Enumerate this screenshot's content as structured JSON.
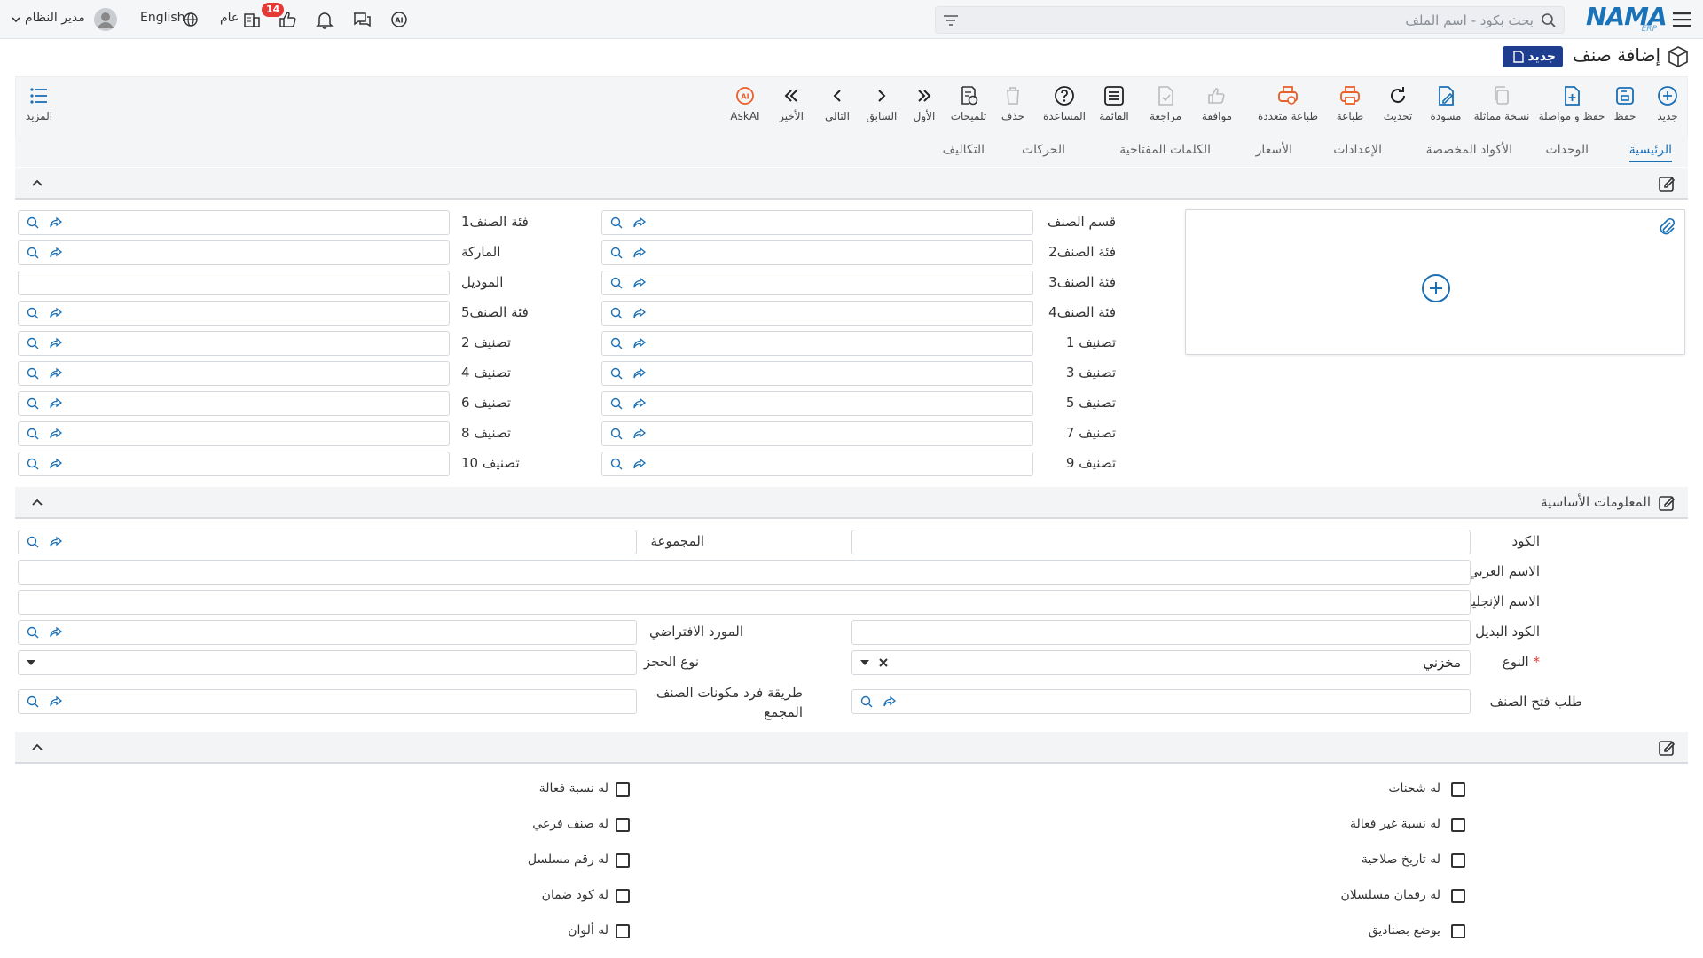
{
  "topbar": {
    "logo_text": "NAMA",
    "logo_sub": "ERP",
    "search_placeholder": "بحث بكود - اسم الملف",
    "notification_count": "14",
    "scope_label": "عام",
    "language_label": "English",
    "user_name": "مدير النظام"
  },
  "page": {
    "title": "إضافة صنف",
    "status_badge": "جديد"
  },
  "toolbar": {
    "new": "جديد",
    "save": "حفظ",
    "save_continue": "حفظ و مواصلة",
    "copy": "نسخة مماثلة",
    "draft": "مسودة",
    "refresh": "تحديث",
    "print": "طباعة",
    "multi_print": "طباعة متعددة",
    "approve": "موافقة",
    "review": "مراجعة",
    "list": "القائمة",
    "help": "المساعدة",
    "delete": "حذف",
    "hints": "تلميحات",
    "first": "الأول",
    "previous": "السابق",
    "next": "التالي",
    "last": "الأخير",
    "askai": "AskAI",
    "more": "المزيد"
  },
  "tabs": [
    "الرئيسية",
    "الوحدات",
    "الأكواد المخصصة",
    "الإعدادات",
    "الأسعار",
    "الكلمات المفتاحية",
    "الحركات",
    "التكاليف"
  ],
  "classification": {
    "right_labels": [
      "قسم الصنف",
      "فئة الصنف2",
      "فئة الصنف3",
      "فئة الصنف4",
      "تصنيف 1",
      "تصنيف 3",
      "تصنيف 5",
      "تصنيف 7",
      "تصنيف 9"
    ],
    "left_labels": [
      "فئة الصنف1",
      "الماركة",
      "الموديل",
      "فئة الصنف5",
      "تصنيف 2",
      "تصنيف 4",
      "تصنيف 6",
      "تصنيف 8",
      "تصنيف 10"
    ]
  },
  "basic_info": {
    "section_title": "المعلومات الأساسية",
    "code": "الكود",
    "arabic_name": "الاسم العربي",
    "english_name": "الاسم الإنجليزي",
    "alt_code": "الكود البديل",
    "type": "النوع",
    "type_value": "مخزني",
    "item_open_request": "طلب فتح الصنف",
    "group": "المجموعة",
    "default_supplier": "المورد الافتراضي",
    "booking_type": "نوع الحجز",
    "bundle_method": "طريقة فرد مكونات الصنف المجمع"
  },
  "options": {
    "right": [
      "له شحنات",
      "له نسبة غير فعالة",
      "له تاريخ صلاحية",
      "له رقمان مسلسلان",
      "يوضع بصناديق"
    ],
    "left": [
      "له نسبة فعالة",
      "له صنف فرعي",
      "له رقم مسلسل",
      "له كود ضمان",
      "له ألوان"
    ]
  },
  "colors": {
    "accent": "#1a6fb5",
    "badge": "#e53935",
    "print_orange": "#e8612c",
    "status_badge": "#1e3d8f"
  }
}
